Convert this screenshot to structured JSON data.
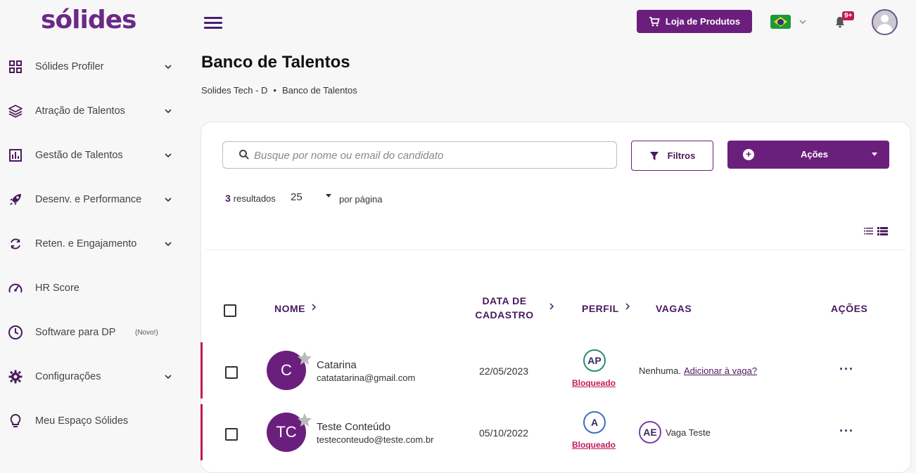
{
  "brand": {
    "logo_text": "sólides",
    "color": "#6b2a86"
  },
  "sidebar": {
    "items": [
      {
        "label": "Sólides Profiler",
        "icon": "grid-icon",
        "chevron": true
      },
      {
        "label": "Atração de Talentos",
        "icon": "layers-icon",
        "chevron": true
      },
      {
        "label": "Gestão de Talentos",
        "icon": "bar-chart-icon",
        "chevron": true
      },
      {
        "label": "Desenv. e Performance",
        "icon": "rocket-icon",
        "chevron": true
      },
      {
        "label": "Reten. e Engajamento",
        "icon": "refresh-icon",
        "chevron": true
      },
      {
        "label": "HR Score",
        "icon": "speedometer-icon",
        "chevron": false
      },
      {
        "label": "Software para DP",
        "icon": "clock-icon",
        "chevron": false,
        "badge": "(Novo!)"
      },
      {
        "label": "Configurações",
        "icon": "gear-icon",
        "chevron": true
      },
      {
        "label": "Meu Espaço Sólides",
        "icon": "lightbulb-icon",
        "chevron": false
      }
    ]
  },
  "header": {
    "shop_label": "Loja de Produtos",
    "notifications_badge": "9+",
    "language_flag": "brazil-flag-icon"
  },
  "page": {
    "title": "Banco de Talentos",
    "breadcrumb": [
      "Solides Tech - D",
      "•",
      "Banco de Talentos"
    ]
  },
  "toolbar": {
    "search_placeholder": "Busque por nome ou email do candidato",
    "filters_label": "Filtros",
    "actions_label": "Ações"
  },
  "pagination": {
    "results_count": "3",
    "results_label": "resultados",
    "per_page_value": "25",
    "per_page_label": "por página"
  },
  "table": {
    "headers": {
      "name": "NOME",
      "date_line1": "DATA DE",
      "date_line2": "CADASTRO",
      "profile": "PERFIL",
      "jobs": "VAGAS",
      "actions": "AÇÕES"
    },
    "rows": [
      {
        "initials": "C",
        "name": "Catarina",
        "email": "catatatarina@gmail.com",
        "date": "22/05/2023",
        "profile": "AP",
        "profile_status": "Bloqueado",
        "jobs_text": "Nenhuma.",
        "jobs_link": "Adicionar à vaga?",
        "more": "···"
      },
      {
        "initials": "TC",
        "name": "Teste Conteúdo",
        "email": "testeconteudo@teste.com.br",
        "date": "05/10/2022",
        "profile": "A",
        "profile_status": "Bloqueado",
        "job_initials": "AE",
        "job_name": "Vaga Teste",
        "more": "···"
      }
    ]
  },
  "colors": {
    "primary": "#6b1f7c",
    "accent": "#c2185b",
    "header_text": "#4a1a5c"
  }
}
